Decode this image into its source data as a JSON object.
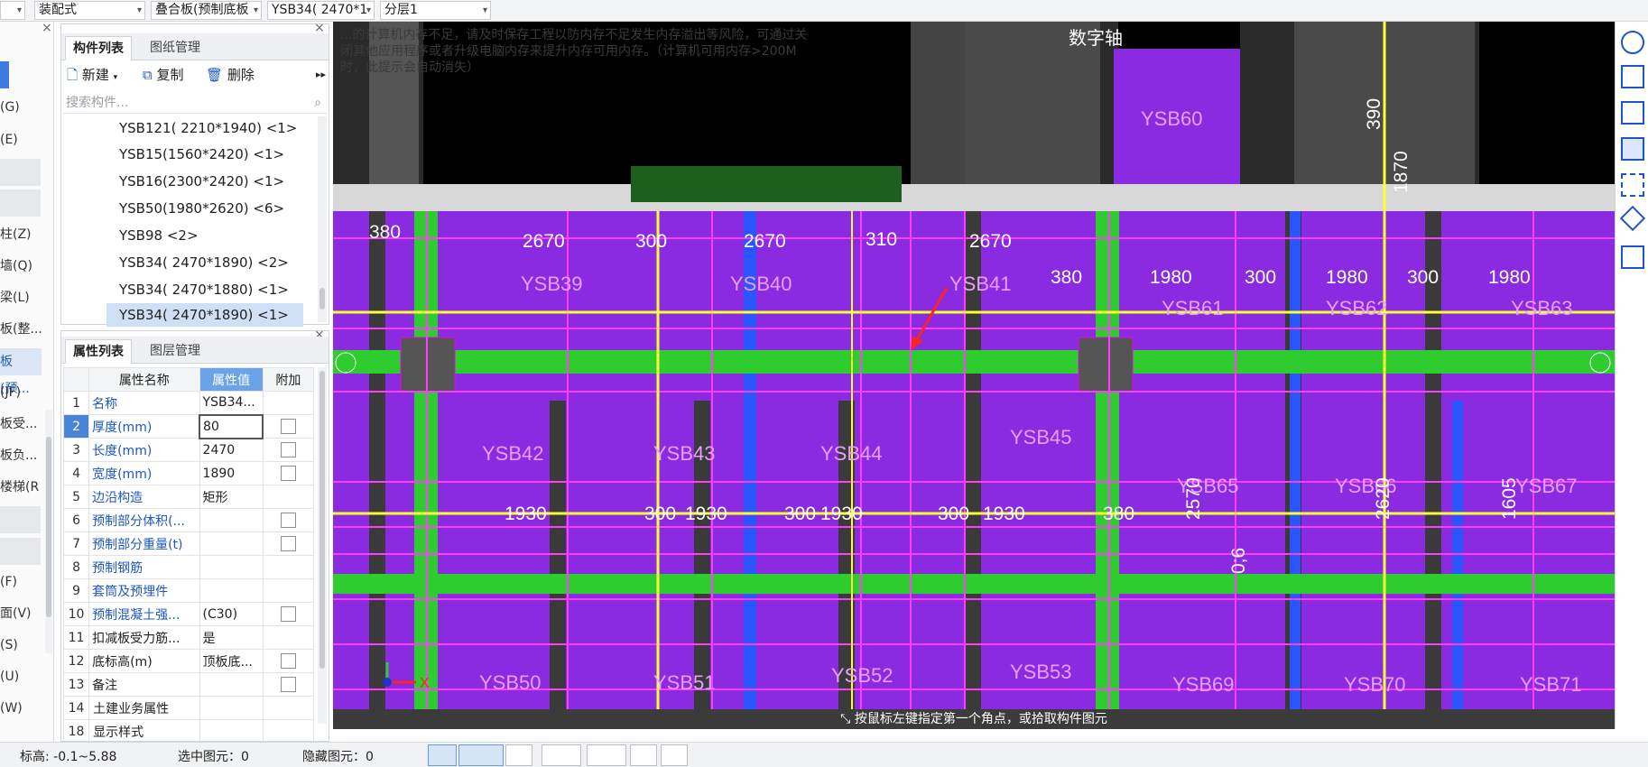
{
  "toolbar": {
    "dropdown1": "",
    "dropdown2": "装配式",
    "dropdown3": "叠合板(预制底板",
    "dropdown4": "YSB34( 2470*1",
    "dropdown5": "分层1"
  },
  "leftnav": {
    "items": [
      "(G)",
      "(E)",
      "柱(Z)",
      "墙(Q)",
      "梁(L)",
      "板(整...",
      "板(预...",
      "(JF)",
      "板受...",
      "板负...",
      "楼梯(R",
      "(F)",
      "面(V)",
      "(S)",
      "(U)",
      "(W)"
    ]
  },
  "component_panel": {
    "tabs": [
      "构件列表",
      "图纸管理"
    ],
    "toolbar": {
      "new": "新建",
      "copy": "复制",
      "delete": "删除"
    },
    "search_placeholder": "搜索构件...",
    "items": [
      "YSB121( 2210*1940) <1>",
      "YSB15(1560*2420) <1>",
      "YSB16(2300*2420) <1>",
      "YSB50(1980*2620) <6>",
      "YSB98 <2>",
      "YSB34( 2470*1890) <2>",
      "YSB34( 2470*1880)   <1>",
      "YSB34( 2470*1890)   <1>"
    ]
  },
  "property_panel": {
    "tabs": [
      "属性列表",
      "图层管理"
    ],
    "headers": [
      "属性名称",
      "属性值",
      "附加"
    ],
    "rows": [
      {
        "n": "1",
        "name": "名称",
        "val": "YSB34...",
        "chk": false
      },
      {
        "n": "2",
        "name": "厚度(mm)",
        "val": "80",
        "chk": true
      },
      {
        "n": "3",
        "name": "长度(mm)",
        "val": "2470",
        "chk": true
      },
      {
        "n": "4",
        "name": "宽度(mm)",
        "val": "1890",
        "chk": true
      },
      {
        "n": "5",
        "name": "边沿构造",
        "val": "矩形",
        "chk": false
      },
      {
        "n": "6",
        "name": "预制部分体积(...",
        "val": "",
        "chk": true
      },
      {
        "n": "7",
        "name": "预制部分重量(t)",
        "val": "",
        "chk": true
      },
      {
        "n": "8",
        "name": "预制钢筋",
        "val": "",
        "chk": false
      },
      {
        "n": "9",
        "name": "套筒及预埋件",
        "val": "",
        "chk": false
      },
      {
        "n": "10",
        "name": "预制混凝土强...",
        "val": "(C30)",
        "chk": true
      },
      {
        "n": "11",
        "name": "扣减板受力筋...",
        "val": "是",
        "chk": false
      },
      {
        "n": "12",
        "name": "底标高(m)",
        "val": "顶板底...",
        "chk": true
      },
      {
        "n": "13",
        "name": "备注",
        "val": "",
        "chk": true
      },
      {
        "n": "14",
        "name": "土建业务属性",
        "val": "",
        "chk": false
      },
      {
        "n": "18",
        "name": "显示样式",
        "val": "",
        "chk": false
      }
    ]
  },
  "canvas": {
    "warning": "...的计算机内存不足，请及时保存工程以防内存不足发生内存溢出等风险，可通过关闭其他应用程序或者升级电脑内存来提升内存可用内存。（计算机可用内存>200M时，此提示会自动消失）",
    "digital_axis": "数字轴",
    "labels": [
      "YSB39",
      "YSB40",
      "YSB41",
      "YSB60",
      "YSB61",
      "YSB62",
      "YSB63",
      "YSB42",
      "YSB43",
      "YSB44",
      "YSB45",
      "YSB65",
      "YSB66",
      "YSB67",
      "YSB50",
      "YSB51",
      "YSB52",
      "YSB53",
      "YSB69",
      "YSB70",
      "YSB71"
    ],
    "dims": [
      "380",
      "2670",
      "300",
      "2670",
      "310",
      "2670",
      "380",
      "1980",
      "300",
      "1980",
      "300",
      "1980",
      "1930",
      "300",
      "1930",
      "300",
      "1930",
      "300",
      "1930",
      "380",
      "2570",
      "2620",
      "1605",
      "390",
      "1870",
      "0;6"
    ],
    "axis_marker": "X",
    "command_hint": "按鼠标左键指定第一个角点，或拾取构件图元"
  },
  "status": {
    "elevation": "标高:  -0.1~5.88",
    "selected": "选中图元：0",
    "hidden": "隐藏图元：0"
  },
  "colors": {
    "slab": "#8a2be2",
    "beam": "#2ecc2e",
    "grid": "#ff3cff",
    "axis": "#ffff33",
    "dim": "#ffffff",
    "label": "#e8a0ff"
  }
}
